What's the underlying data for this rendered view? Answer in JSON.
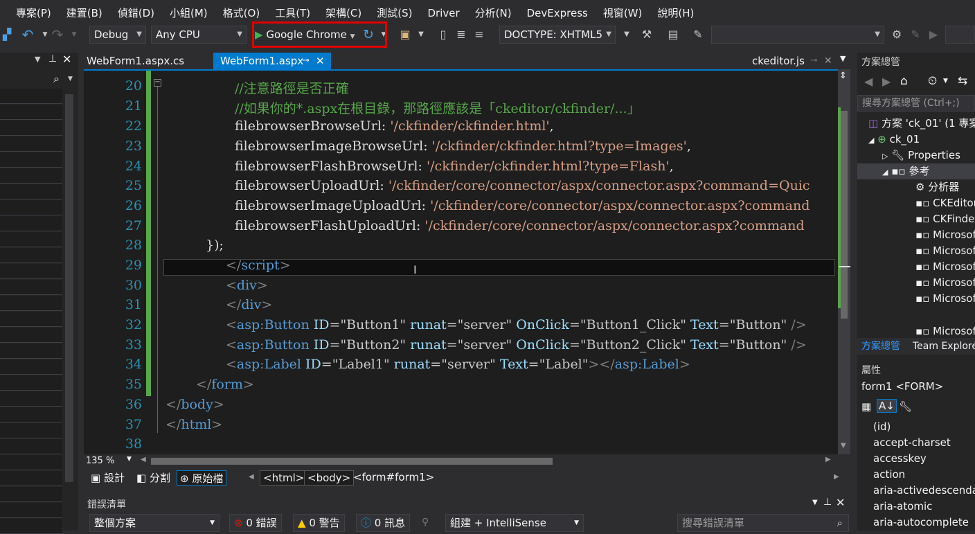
{
  "menu": [
    "專案(P)",
    "建置(B)",
    "偵錯(D)",
    "小組(M)",
    "格式(O)",
    "工具(T)",
    "架構(C)",
    "測試(S)",
    "Driver",
    "分析(N)",
    "DevExpress",
    "視窗(W)",
    "說明(H)"
  ],
  "toolbar": {
    "config": "Debug",
    "platform": "Any CPU",
    "run_target": "Google Chrome",
    "doctype": "DOCTYPE: XHTML5"
  },
  "tabs": {
    "tab1": "WebForm1.aspx.cs",
    "tab2": "WebForm1.aspx",
    "tab3": "ckeditor.js"
  },
  "code_lines": {
    "n20": "20",
    "n21": "21",
    "n22": "22",
    "n23": "23",
    "n24": "24",
    "n25": "25",
    "n26": "26",
    "n27": "27",
    "n28": "28",
    "n29": "29",
    "n30": "30",
    "n31": "31",
    "n32": "32",
    "n33": "33",
    "n34": "34",
    "n35": "35",
    "n36": "36",
    "n37": "37",
    "n38": "38",
    "l20": "//注意路徑是否正確",
    "l21": "//如果你的*.aspx在根目錄，那路徑應該是「ckeditor/ckfinder/...」",
    "l22k": "filebrowserBrowseUrl: ",
    "l22s": "'/ckfinder/ckfinder.html'",
    "l22e": ",",
    "l23k": "filebrowserImageBrowseUrl: ",
    "l23s": "'/ckfinder/ckfinder.html?type=Images'",
    "l23e": ",",
    "l24k": "filebrowserFlashBrowseUrl: ",
    "l24s": "'/ckfinder/ckfinder.html?type=Flash'",
    "l24e": ",",
    "l25k": "filebrowserUploadUrl: ",
    "l25s": "'/ckfinder/core/connector/aspx/connector.aspx?command=Quic",
    "l26k": "filebrowserImageUploadUrl: ",
    "l26s": "'/ckfinder/core/connector/aspx/connector.aspx?command",
    "l27k": "filebrowserFlashUploadUrl: ",
    "l27s": "'/ckfinder/core/connector/aspx/connector.aspx?command",
    "l28": "});",
    "l29a": "</",
    "l29b": "script",
    "l29c": ">",
    "l30a": "<",
    "l30b": "div",
    "l30c": ">",
    "l31a": "</",
    "l31b": "div",
    "l31c": ">",
    "l32": {
      "a": "<",
      "b": "asp",
      "c": ":",
      "d": "Button",
      "e": " ID",
      "f": "=",
      "g": "\"Button1\"",
      "h": " runat",
      "i": "=",
      "j": "\"server\"",
      "k": " OnClick",
      "l": "=",
      "m": "\"Button1_Click\"",
      "n": " Text",
      "o": "=",
      "p": "\"Button\"",
      "q": " />"
    },
    "l33": {
      "a": "<",
      "b": "asp",
      "c": ":",
      "d": "Button",
      "e": " ID",
      "f": "=",
      "g": "\"Button2\"",
      "h": " runat",
      "i": "=",
      "j": "\"server\"",
      "k": " OnClick",
      "l": "=",
      "m": "\"Button2_Click\"",
      "n": " Text",
      "o": "=",
      "p": "\"Button\"",
      "q": " />"
    },
    "l34": {
      "a": "<",
      "b": "asp",
      "c": ":",
      "d": "Label",
      "e": " ID",
      "f": "=",
      "g": "\"Label1\"",
      "h": " runat",
      "i": "=",
      "j": "\"server\"",
      "k": " Text",
      "l": "=",
      "m": "\"Label\"",
      "n": "></",
      "o": "asp",
      "p": ":",
      "q": "Label",
      "r": ">"
    },
    "l35a": "</",
    "l35b": "form",
    "l35c": ">",
    "l36a": "</",
    "l36b": "body",
    "l36c": ">",
    "l37a": "</",
    "l37b": "html",
    "l37c": ">"
  },
  "editor_footer": {
    "zoom": "135 %",
    "design": "設計",
    "split": "分割",
    "source": "原始檔",
    "crumbs": [
      "<html>",
      "<body>",
      "<form#form1>"
    ]
  },
  "error_list": {
    "title": "錯誤清單",
    "scope": "整個方案",
    "errors": "0 錯誤",
    "warnings": "0 警告",
    "messages": "0 訊息",
    "build_filter": "組建 + IntelliSense",
    "search_placeholder": "搜尋錯誤清單"
  },
  "solution_explorer": {
    "title": "方案總管",
    "search_placeholder": "搜尋方案總管 (Ctrl+;)",
    "solution": "方案 'ck_01' (1 專案",
    "project": "ck_01",
    "properties": "Properties",
    "references": "參考",
    "items": [
      "分析器",
      "CKEditor",
      "CKFinder",
      "Microsof",
      "Microsof",
      "Microsof",
      "Microsof",
      "Microsof",
      "Microsof"
    ],
    "tab_solution": "方案總管",
    "tab_team": "Team Explore"
  },
  "properties": {
    "title": "屬性",
    "object": "form1",
    "object_type": "<FORM>",
    "rows": [
      "(id)",
      "accept-charset",
      "accesskey",
      "action",
      "aria-activedescendan",
      "aria-atomic",
      "aria-autocomplete"
    ]
  }
}
